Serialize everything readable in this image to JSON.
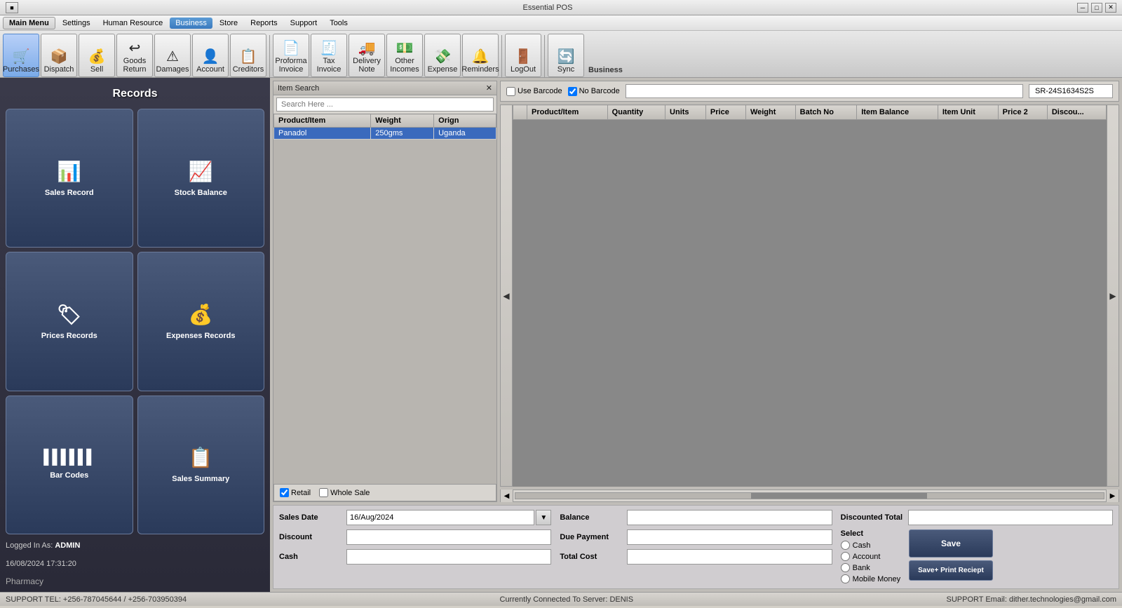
{
  "app": {
    "title": "Essential POS"
  },
  "titlebar": {
    "minimize": "─",
    "maximize": "□",
    "close": "✕"
  },
  "menu": {
    "main_menu": "Main Menu",
    "items": [
      {
        "label": "Settings",
        "active": false
      },
      {
        "label": "Human Resource",
        "active": false
      },
      {
        "label": "Business",
        "active": true
      },
      {
        "label": "Store",
        "active": false
      },
      {
        "label": "Reports",
        "active": false
      },
      {
        "label": "Support",
        "active": false
      },
      {
        "label": "Tools",
        "active": false
      }
    ]
  },
  "toolbar": {
    "buttons": [
      {
        "label": "Purchases",
        "icon": "🛒",
        "active": true
      },
      {
        "label": "Dispatch",
        "icon": "📦",
        "active": false
      },
      {
        "label": "Sell",
        "icon": "💰",
        "active": false
      },
      {
        "label": "Goods Return",
        "icon": "↩",
        "active": false
      },
      {
        "label": "Damages",
        "icon": "⚠",
        "active": false
      },
      {
        "label": "Account",
        "icon": "👤",
        "active": false
      },
      {
        "label": "Creditors",
        "icon": "📋",
        "active": false
      },
      {
        "label": "Proforma Invoice",
        "icon": "📄",
        "active": false
      },
      {
        "label": "Tax Invoice",
        "icon": "🧾",
        "active": false
      },
      {
        "label": "Delivery Note",
        "icon": "🚚",
        "active": false
      },
      {
        "label": "Other Incomes",
        "icon": "💵",
        "active": false
      },
      {
        "label": "Expense",
        "icon": "💸",
        "active": false
      },
      {
        "label": "Reminders",
        "icon": "🔔",
        "active": false
      },
      {
        "label": "LogOut",
        "icon": "🚪",
        "active": false
      },
      {
        "label": "Sync",
        "icon": "🔄",
        "active": false
      }
    ],
    "group_label": "Business"
  },
  "records": {
    "title": "Records",
    "buttons": [
      {
        "label": "Sales Record",
        "icon": "📊"
      },
      {
        "label": "Stock Balance",
        "icon": "📈"
      },
      {
        "label": "Prices Records",
        "icon": "🏷"
      },
      {
        "label": "Expenses Records",
        "icon": "💰"
      },
      {
        "label": "Bar Codes",
        "icon": "▬▬▬"
      },
      {
        "label": "Sales Summary",
        "icon": "📋"
      }
    ]
  },
  "user": {
    "logged_in_label": "Logged In As:",
    "username": "ADMIN",
    "datetime": "16/08/2024 17:31:20",
    "store": "Pharmacy"
  },
  "item_search": {
    "title": "Item Search",
    "placeholder": "Search Here ...",
    "columns": [
      "Product/Item",
      "Weight",
      "Orign"
    ],
    "rows": [
      {
        "product": "Panadol",
        "weight": "250gms",
        "origin": "Uganda"
      }
    ]
  },
  "barcode": {
    "use_barcode_label": "Use Barcode",
    "no_barcode_label": "No Barcode",
    "barcode_value": "SR-24S1634S2S",
    "use_barcode_checked": false,
    "no_barcode_checked": true
  },
  "sales_table": {
    "columns": [
      "Product/Item",
      "Quantity",
      "Units",
      "Price",
      "Weight",
      "Batch No",
      "Item Balance",
      "Item Unit",
      "Price 2",
      "Discou..."
    ]
  },
  "sale_type": {
    "retail_label": "Retail",
    "whole_sale_label": "Whole Sale",
    "retail_checked": true,
    "whole_sale_checked": false
  },
  "form": {
    "sales_date_label": "Sales Date",
    "sales_date_value": "16/Aug/2024",
    "balance_label": "Balance",
    "discounted_total_label": "Discounted Total",
    "discount_label": "Discount",
    "due_payment_label": "Due Payment",
    "select_label": "Select",
    "cash_label": "Cash",
    "total_cost_label": "Total Cost",
    "cash_option": "Cash",
    "account_option": "Account",
    "bank_option": "Bank",
    "mobile_money_option": "Mobile Money",
    "save_label": "Save",
    "save_print_label": "Save+ Print Reciept"
  },
  "status": {
    "support_tel": "SUPPORT TEL: +256-787045644 / +256-703950394",
    "connected": "Currently Connected To Server: DENIS",
    "support_email": "SUPPORT Email: dither.technologies@gmail.com"
  }
}
